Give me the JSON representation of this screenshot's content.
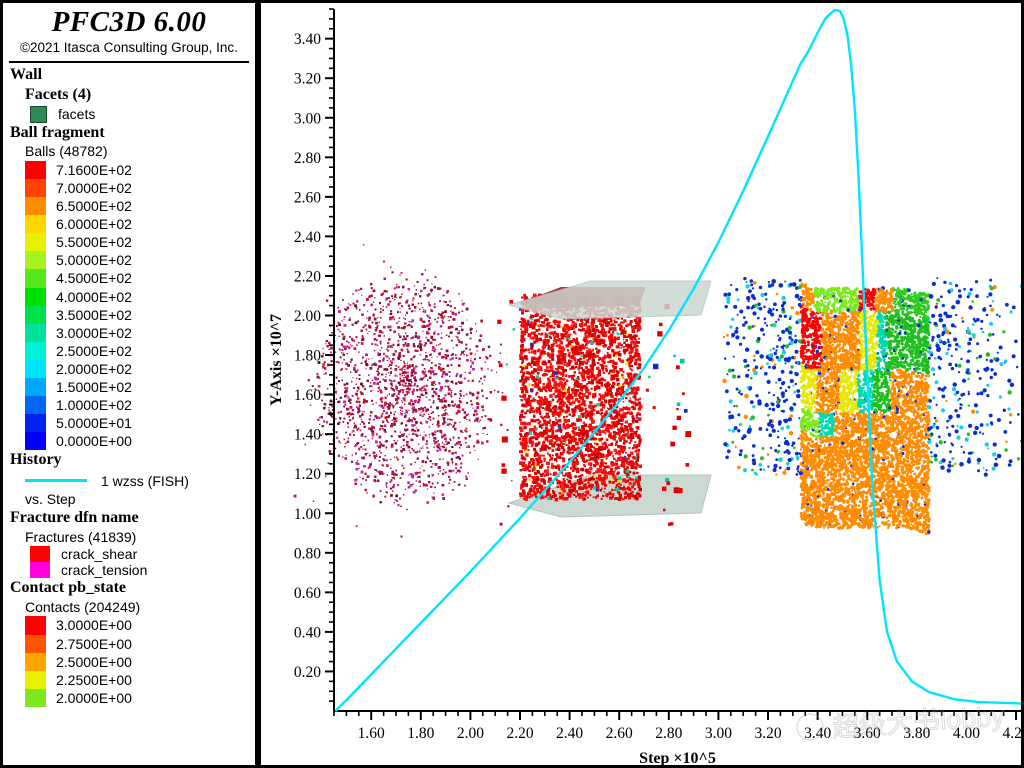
{
  "app": {
    "title": "PFC3D 6.00",
    "copyright": "©2021 Itasca Consulting Group, Inc."
  },
  "legend": {
    "wall": {
      "heading": "Wall",
      "subheading": "Facets (4)",
      "item_label": "facets",
      "item_color": "#2e8b57"
    },
    "ball_fragment": {
      "heading": "Ball fragment",
      "count_label": "Balls (48782)",
      "entries": [
        {
          "value": "7.1600E+02",
          "color": "#ff0000"
        },
        {
          "value": "7.0000E+02",
          "color": "#ff4400"
        },
        {
          "value": "6.5000E+02",
          "color": "#ff8c00"
        },
        {
          "value": "6.0000E+02",
          "color": "#ffd700"
        },
        {
          "value": "5.5000E+02",
          "color": "#e8f000"
        },
        {
          "value": "5.0000E+02",
          "color": "#a6f223"
        },
        {
          "value": "4.5000E+02",
          "color": "#55e61e"
        },
        {
          "value": "4.0000E+02",
          "color": "#00e000"
        },
        {
          "value": "3.5000E+02",
          "color": "#00e04a"
        },
        {
          "value": "3.0000E+02",
          "color": "#00e29b"
        },
        {
          "value": "2.5000E+02",
          "color": "#00f0d8"
        },
        {
          "value": "2.0000E+02",
          "color": "#00e5ff"
        },
        {
          "value": "1.5000E+02",
          "color": "#00a8ff"
        },
        {
          "value": "1.0000E+02",
          "color": "#0066f0"
        },
        {
          "value": "5.0000E+01",
          "color": "#0022ee"
        },
        {
          "value": "0.0000E+00",
          "color": "#0000ff"
        }
      ]
    },
    "history": {
      "heading": "History",
      "series_label": "1 wzss (FISH)",
      "versus_label": "vs. Step",
      "line_color": "#00e5ff"
    },
    "fracture": {
      "heading": "Fracture dfn name",
      "count_label": "Fractures (41839)",
      "entries": [
        {
          "label": "crack_shear",
          "color": "#ff0000"
        },
        {
          "label": "crack_tension",
          "color": "#ff00dd"
        }
      ]
    },
    "contact": {
      "heading": "Contact pb_state",
      "count_label": "Contacts (204249)",
      "entries": [
        {
          "value": "3.0000E+00",
          "color": "#ff0000"
        },
        {
          "value": "2.7500E+00",
          "color": "#ff5500"
        },
        {
          "value": "2.5000E+00",
          "color": "#ffa500"
        },
        {
          "value": "2.2500E+00",
          "color": "#e8f000"
        },
        {
          "value": "2.0000E+00",
          "color": "#7ee81e"
        }
      ]
    }
  },
  "chart_data": {
    "type": "line",
    "title": "",
    "xlabel": "Step ×10^5",
    "ylabel": "Y-Axis ×10^7",
    "xlim": [
      1.45,
      4.22
    ],
    "ylim": [
      0.0,
      3.55
    ],
    "xticks": [
      "1.60",
      "1.80",
      "2.00",
      "2.20",
      "2.40",
      "2.60",
      "2.80",
      "3.00",
      "3.20",
      "3.40",
      "3.60",
      "3.80",
      "4.00",
      "4.20"
    ],
    "xtick_values": [
      1.6,
      1.8,
      2.0,
      2.2,
      2.4,
      2.6,
      2.8,
      3.0,
      3.2,
      3.4,
      3.6,
      3.8,
      4.0,
      4.2
    ],
    "yticks": [
      "0.20",
      "0.40",
      "0.60",
      "0.80",
      "1.00",
      "1.20",
      "1.40",
      "1.60",
      "1.80",
      "2.00",
      "2.20",
      "2.40",
      "2.60",
      "2.80",
      "3.00",
      "3.20",
      "3.40"
    ],
    "ytick_values": [
      0.2,
      0.4,
      0.6,
      0.8,
      1.0,
      1.2,
      1.4,
      1.6,
      1.8,
      2.0,
      2.2,
      2.4,
      2.6,
      2.8,
      3.0,
      3.2,
      3.4
    ],
    "minor_tick_step": 0.05,
    "grid": false,
    "legend_position": "external-left",
    "series": [
      {
        "name": "1 wzss (FISH)",
        "color": "#00e5ff",
        "x": [
          1.455,
          1.5,
          1.6,
          1.7,
          1.8,
          1.9,
          2.0,
          2.1,
          2.2,
          2.3,
          2.4,
          2.5,
          2.6,
          2.7,
          2.8,
          2.9,
          3.0,
          3.1,
          3.2,
          3.28,
          3.33,
          3.36,
          3.4,
          3.43,
          3.45,
          3.47,
          3.49,
          3.505,
          3.52,
          3.535,
          3.55,
          3.565,
          3.58,
          3.6,
          3.62,
          3.65,
          3.68,
          3.72,
          3.78,
          3.85,
          3.95,
          4.05,
          4.22
        ],
        "y": [
          0.0,
          0.055,
          0.185,
          0.315,
          0.445,
          0.575,
          0.705,
          0.84,
          0.975,
          1.115,
          1.26,
          1.41,
          1.565,
          1.735,
          1.925,
          2.135,
          2.37,
          2.63,
          2.905,
          3.13,
          3.27,
          3.33,
          3.43,
          3.5,
          3.525,
          3.545,
          3.54,
          3.5,
          3.42,
          3.27,
          3.04,
          2.7,
          2.28,
          1.7,
          1.15,
          0.66,
          0.4,
          0.25,
          0.15,
          0.095,
          0.06,
          0.045,
          0.038
        ]
      }
    ]
  },
  "models": [
    {
      "name": "crack-cloud-model",
      "kind": "fracture-cloud"
    },
    {
      "name": "specimen-with-walls-model",
      "kind": "specimen-red"
    },
    {
      "name": "fragment-coloured-model",
      "kind": "specimen-fragments"
    }
  ],
  "watermark": {
    "text": "lobby"
  }
}
